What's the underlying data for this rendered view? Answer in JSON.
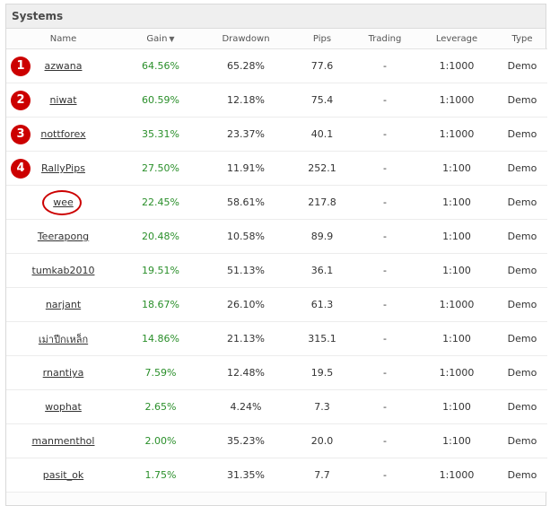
{
  "panel": {
    "title": "Systems"
  },
  "columns": [
    "Name",
    "Gain",
    "Drawdown",
    "Pips",
    "Trading",
    "Leverage",
    "Type"
  ],
  "sort_indicator": "▼",
  "rows": [
    {
      "rank": "1",
      "name": "azwana",
      "gain": "64.56%",
      "drawdown": "65.28%",
      "pips": "77.6",
      "trading": "-",
      "leverage": "1:1000",
      "type": "Demo"
    },
    {
      "rank": "2",
      "name": "niwat",
      "gain": "60.59%",
      "drawdown": "12.18%",
      "pips": "75.4",
      "trading": "-",
      "leverage": "1:1000",
      "type": "Demo"
    },
    {
      "rank": "3",
      "name": "nottforex",
      "gain": "35.31%",
      "drawdown": "23.37%",
      "pips": "40.1",
      "trading": "-",
      "leverage": "1:1000",
      "type": "Demo"
    },
    {
      "rank": "4",
      "name": "RallyPips",
      "gain": "27.50%",
      "drawdown": "11.91%",
      "pips": "252.1",
      "trading": "-",
      "leverage": "1:100",
      "type": "Demo"
    },
    {
      "rank": "",
      "name": "wee",
      "gain": "22.45%",
      "drawdown": "58.61%",
      "pips": "217.8",
      "trading": "-",
      "leverage": "1:100",
      "type": "Demo",
      "circled": true
    },
    {
      "rank": "",
      "name": "Teerapong",
      "gain": "20.48%",
      "drawdown": "10.58%",
      "pips": "89.9",
      "trading": "-",
      "leverage": "1:100",
      "type": "Demo"
    },
    {
      "rank": "",
      "name": "tumkab2010",
      "gain": "19.51%",
      "drawdown": "51.13%",
      "pips": "36.1",
      "trading": "-",
      "leverage": "1:100",
      "type": "Demo"
    },
    {
      "rank": "",
      "name": "narjant",
      "gain": "18.67%",
      "drawdown": "26.10%",
      "pips": "61.3",
      "trading": "-",
      "leverage": "1:1000",
      "type": "Demo"
    },
    {
      "rank": "",
      "name": "เม่าปีกเหล็ก",
      "gain": "14.86%",
      "drawdown": "21.13%",
      "pips": "315.1",
      "trading": "-",
      "leverage": "1:100",
      "type": "Demo"
    },
    {
      "rank": "",
      "name": "rnantiya",
      "gain": "7.59%",
      "drawdown": "12.48%",
      "pips": "19.5",
      "trading": "-",
      "leverage": "1:1000",
      "type": "Demo"
    },
    {
      "rank": "",
      "name": "wophat",
      "gain": "2.65%",
      "drawdown": "4.24%",
      "pips": "7.3",
      "trading": "-",
      "leverage": "1:100",
      "type": "Demo"
    },
    {
      "rank": "",
      "name": "manmenthol",
      "gain": "2.00%",
      "drawdown": "35.23%",
      "pips": "20.0",
      "trading": "-",
      "leverage": "1:100",
      "type": "Demo"
    },
    {
      "rank": "",
      "name": "pasit_ok",
      "gain": "1.75%",
      "drawdown": "31.35%",
      "pips": "7.7",
      "trading": "-",
      "leverage": "1:1000",
      "type": "Demo"
    }
  ],
  "colors": {
    "gain": "#2a8f2a",
    "badge": "#cc0000",
    "header_bg": "#efefef"
  }
}
